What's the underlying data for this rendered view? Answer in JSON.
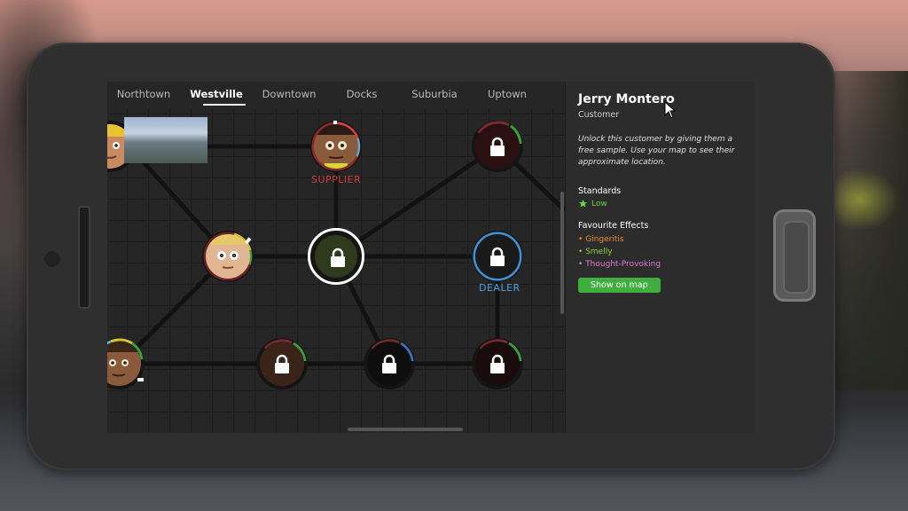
{
  "tabs": [
    "Northtown",
    "Westville",
    "Downtown",
    "Docks",
    "Suburbia",
    "Uptown"
  ],
  "active_tab": "Westville",
  "node_labels": {
    "supplier": "SUPPLIER",
    "dealer": "DEALER"
  },
  "panel": {
    "name": "Jerry Montero",
    "type": "Customer",
    "description": "Unlock this customer by giving them a free sample. Use your map to see their approximate location.",
    "standards_title": "Standards",
    "standards_value": "Low",
    "effects_title": "Favourite Effects",
    "effects": [
      {
        "bullet": "•",
        "name": "Gingeritis",
        "color": "#e8902b"
      },
      {
        "bullet": "•",
        "name": "Smelly",
        "color": "#8fd43c"
      },
      {
        "bullet": "•",
        "name": "Thought-Provoking",
        "color": "#e27ad6"
      }
    ],
    "button_label": "Show on map"
  },
  "colors": {
    "supplier": "#d13b3b",
    "dealer": "#3f8fd1",
    "accent_green": "#3fae3f"
  }
}
